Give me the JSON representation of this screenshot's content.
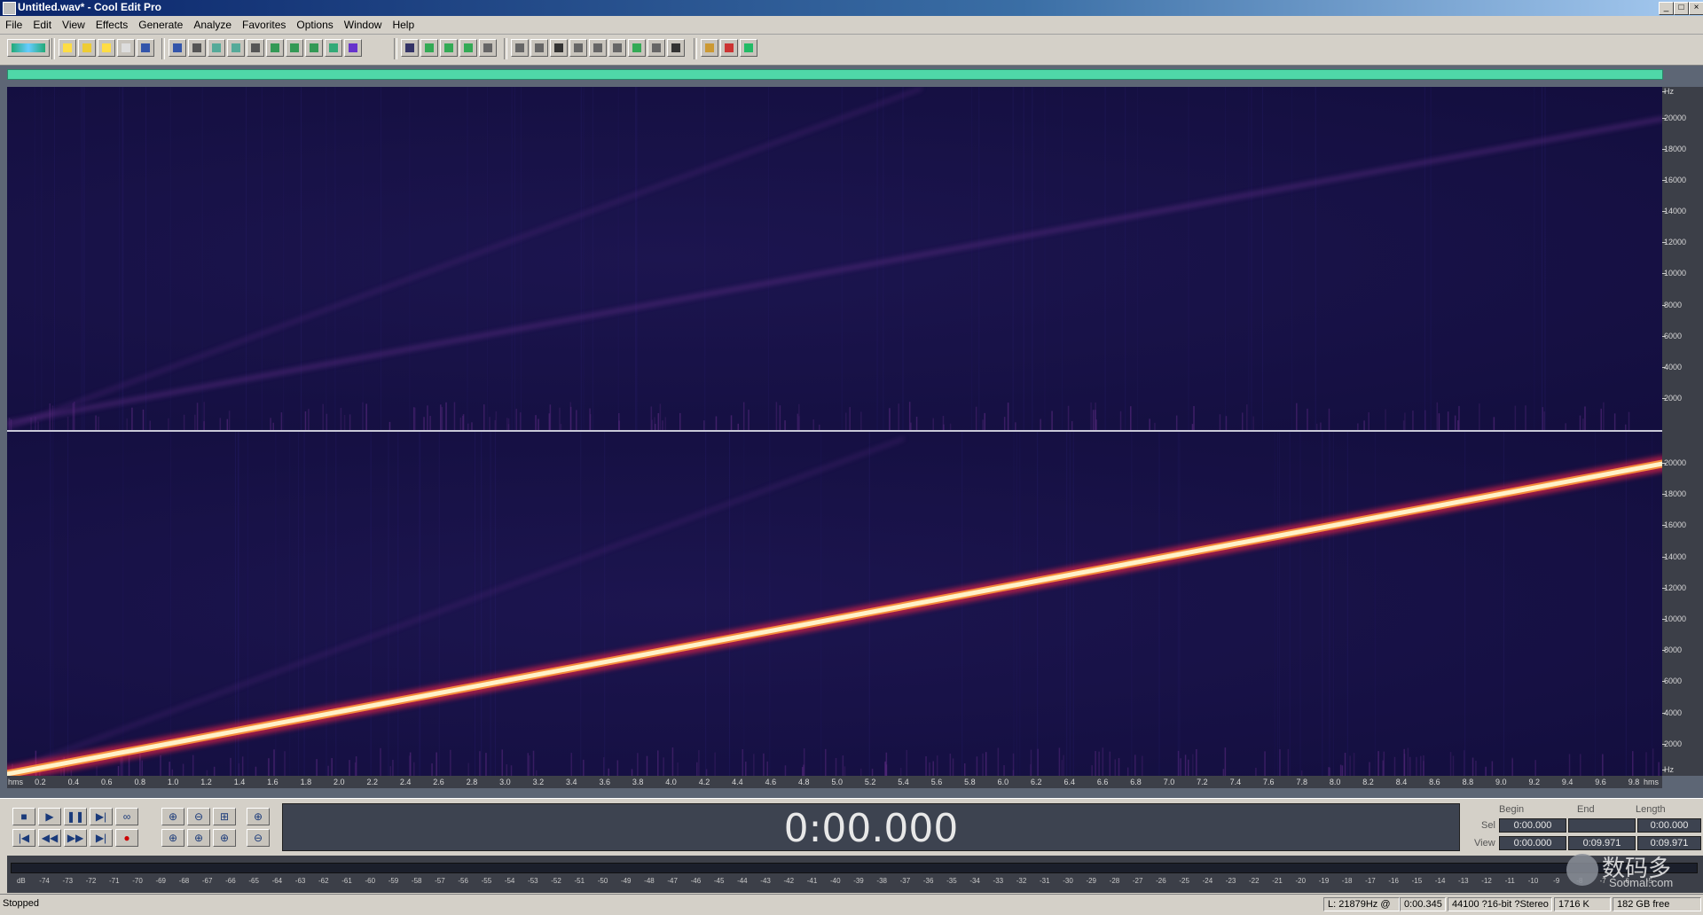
{
  "window": {
    "title": "Untitled.wav* - Cool Edit Pro",
    "controls": [
      "_",
      "□",
      "×"
    ]
  },
  "menu": [
    "File",
    "Edit",
    "View",
    "Effects",
    "Generate",
    "Analyze",
    "Favorites",
    "Options",
    "Window",
    "Help"
  ],
  "toolbar": {
    "icons": [
      "waveform-view-icon",
      "new-file-icon",
      "open-file-icon",
      "save-icon",
      "save-all-icon",
      "close-file-icon",
      "undo-icon",
      "redo-icon",
      "trim-icon",
      "copy-icon",
      "copy-to-new-icon",
      "cut-icon",
      "paste-icon",
      "paste-to-new-icon",
      "mix-paste-icon",
      "insert-cd-icon",
      "spectral-view-icon",
      "envelope-icon",
      "spectral-display-icon",
      "spectral-pan-icon",
      "spectral-phase-icon",
      "cue-list-icon",
      "play-list-icon",
      "settings-icon",
      "play-icon",
      "zoom-icon",
      "bit-depth-icon",
      "grid-icon",
      "info-icon",
      "list-icon",
      "options-icon",
      "preferences-icon",
      "help-icon"
    ]
  },
  "spectrogram": {
    "freq_unit": "Hz",
    "freq_ticks": [
      "20000",
      "18000",
      "16000",
      "14000",
      "12000",
      "10000",
      "8000",
      "6000",
      "4000",
      "2000"
    ],
    "time_unit": "hms",
    "time_ticks": [
      "0.2",
      "0.4",
      "0.6",
      "0.8",
      "1.0",
      "1.2",
      "1.4",
      "1.6",
      "1.8",
      "2.0",
      "2.2",
      "2.4",
      "2.6",
      "2.8",
      "3.0",
      "3.2",
      "3.4",
      "3.6",
      "3.8",
      "4.0",
      "4.2",
      "4.4",
      "4.6",
      "4.8",
      "5.0",
      "5.2",
      "5.4",
      "5.6",
      "5.8",
      "6.0",
      "6.2",
      "6.4",
      "6.6",
      "6.8",
      "7.0",
      "7.2",
      "7.4",
      "7.6",
      "7.8",
      "8.0",
      "8.2",
      "8.4",
      "8.6",
      "8.8",
      "9.0",
      "9.2",
      "9.4",
      "9.6",
      "9.8"
    ]
  },
  "transport": {
    "time_display": "0:00.000",
    "buttons": [
      "stop",
      "play",
      "pause",
      "play-to-end",
      "loop",
      "go-to-start",
      "rewind",
      "fast-forward",
      "go-to-end",
      "record"
    ],
    "zoom_buttons": [
      "zoom-in-horiz",
      "zoom-out-horiz",
      "zoom-full",
      "zoom-in-vert",
      "zoom-in-left",
      "zoom-in-right",
      "zoom-selection",
      "zoom-out-vert"
    ]
  },
  "selection": {
    "headers": [
      "Begin",
      "End",
      "Length"
    ],
    "sel_label": "Sel",
    "view_label": "View",
    "sel_begin": "0:00.000",
    "sel_end": "",
    "sel_length": "0:00.000",
    "view_begin": "0:00.000",
    "view_end": "0:09.971",
    "view_length": "0:09.971"
  },
  "meter": {
    "ticks": [
      "dB",
      "-74",
      "-73",
      "-72",
      "-71",
      "-70",
      "-69",
      "-68",
      "-67",
      "-66",
      "-65",
      "-64",
      "-63",
      "-62",
      "-61",
      "-60",
      "-59",
      "-58",
      "-57",
      "-56",
      "-55",
      "-54",
      "-53",
      "-52",
      "-51",
      "-50",
      "-49",
      "-48",
      "-47",
      "-46",
      "-45",
      "-44",
      "-43",
      "-42",
      "-41",
      "-40",
      "-39",
      "-38",
      "-37",
      "-36",
      "-35",
      "-34",
      "-33",
      "-32",
      "-31",
      "-30",
      "-29",
      "-28",
      "-27",
      "-26",
      "-25",
      "-24",
      "-23",
      "-22",
      "-21",
      "-20",
      "-19",
      "-18",
      "-17",
      "-16",
      "-15",
      "-14",
      "-13",
      "-12",
      "-11",
      "-10",
      "-9",
      "-8",
      "-7",
      "-6",
      "-5"
    ]
  },
  "status": {
    "state": "Stopped",
    "cursor": "L: 21879Hz @",
    "cursor_time": "0:00.345",
    "format": "44100 ?16-bit ?Stereo",
    "size": "1716 K",
    "free": "182 GB free"
  },
  "watermark": {
    "text": "数码多",
    "sub": "Soomal.com"
  },
  "colors": {
    "overview": "#4fd8a8",
    "spectrogram_bg": "#17114a",
    "sweep_hot": "#fff2c8",
    "sweep_glow": "#e0204a",
    "harmonic": "#5a2a80"
  }
}
